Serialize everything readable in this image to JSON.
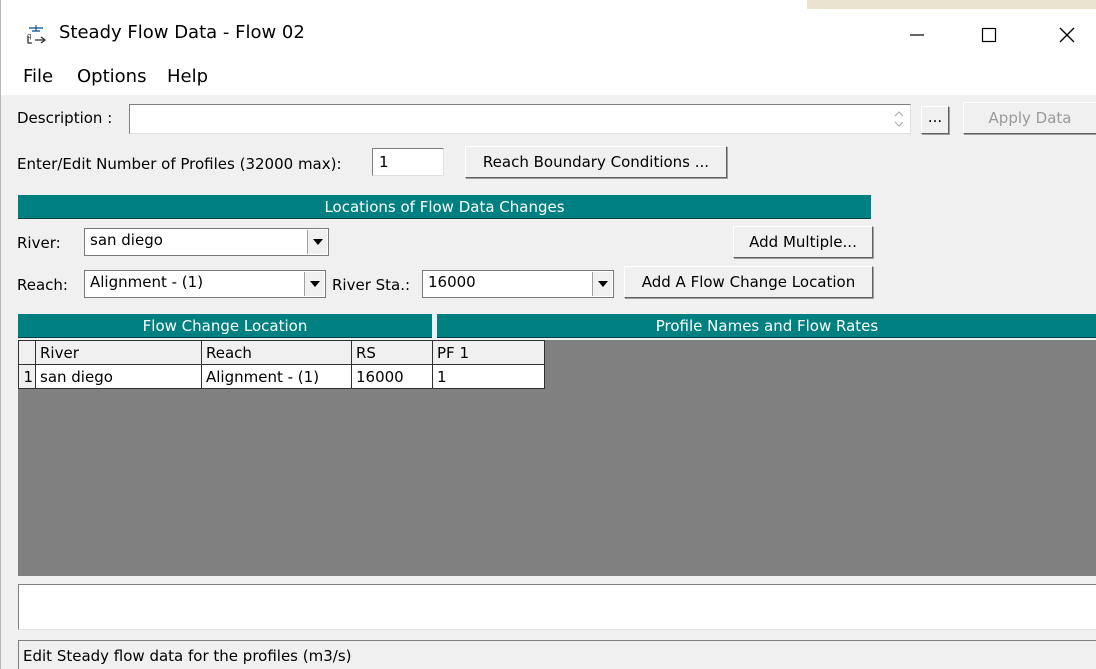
{
  "window": {
    "title": "Steady Flow Data - Flow 02",
    "minimize_icon": "minimize-icon",
    "maximize_icon": "maximize-icon",
    "close_icon": "close-icon"
  },
  "menu": {
    "items": [
      "File",
      "Options",
      "Help"
    ]
  },
  "description": {
    "label": "Description :",
    "value": "",
    "browse_label": "...",
    "apply_label": "Apply Data"
  },
  "profiles": {
    "label": "Enter/Edit Number of Profiles (32000 max):",
    "value": "1",
    "reach_bc_label": "Reach Boundary Conditions ..."
  },
  "locations": {
    "header": "Locations of Flow Data Changes",
    "river_label": "River:",
    "river_value": "san diego",
    "reach_label": "Reach:",
    "reach_value": "Alignment - (1)",
    "river_sta_label": "River Sta.:",
    "river_sta_value": "16000",
    "add_multiple_label": "Add Multiple...",
    "add_flow_change_label": "Add A Flow Change Location"
  },
  "table": {
    "flow_change_header": "Flow Change Location",
    "profile_header": "Profile Names and Flow Rates",
    "columns": [
      "",
      "River",
      "Reach",
      "RS",
      "PF 1"
    ],
    "rows": [
      [
        "1",
        "san diego",
        "Alignment - (1)",
        "16000",
        "1"
      ]
    ]
  },
  "status": {
    "edit_value": "",
    "message": "Edit Steady flow data for the profiles (m3/s)"
  },
  "colors": {
    "header_teal": "#008080",
    "grid_gray": "#808080"
  }
}
